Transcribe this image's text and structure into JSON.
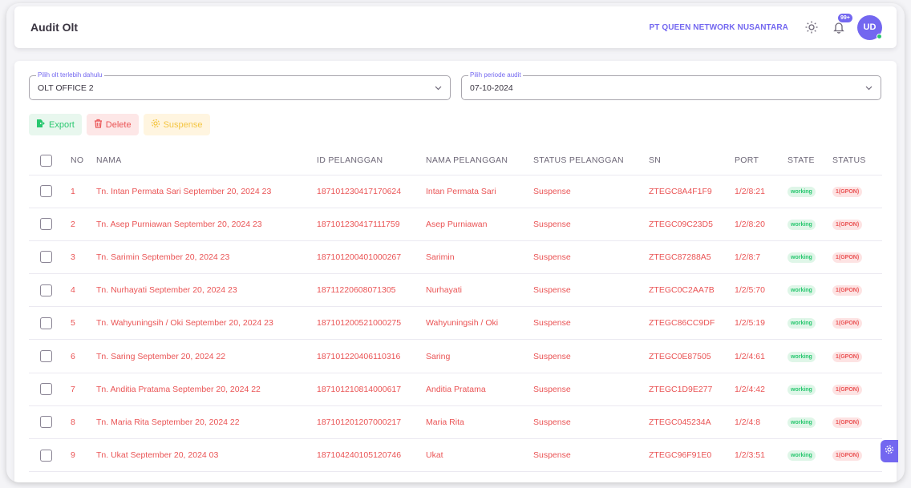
{
  "header": {
    "title": "Audit Olt",
    "company": "PT QUEEN NETWORK NUSANTARA",
    "notif_badge": "99+",
    "avatar_initials": "UD"
  },
  "filters": {
    "olt": {
      "label": "Pilih olt terlebih dahulu",
      "value": "OLT OFFICE 2"
    },
    "period": {
      "label": "Pilih periode audit",
      "value": "07-10-2024"
    }
  },
  "actions": {
    "export": "Export",
    "delete": "Delete",
    "suspense": "Suspense"
  },
  "table": {
    "headers": [
      "NO",
      "NAMA",
      "ID PELANGGAN",
      "NAMA PELANGGAN",
      "STATUS PELANGGAN",
      "SN",
      "PORT",
      "STATE",
      "STATUS"
    ],
    "rows": [
      [
        "1",
        "Tn. Intan Permata Sari September 20, 2024 23",
        "187101230417170624",
        "Intan Permata Sari",
        "Suspense",
        "ZTEGC8A4F1F9",
        "1/2/8:21",
        "working",
        "1(GPON)"
      ],
      [
        "2",
        "Tn. Asep Purniawan September 20, 2024 23",
        "187101230417111759",
        "Asep Purniawan",
        "Suspense",
        "ZTEGC09C23D5",
        "1/2/8:20",
        "working",
        "1(GPON)"
      ],
      [
        "3",
        "Tn. Sarimin September 20, 2024 23",
        "187101200401000267",
        "Sarimin",
        "Suspense",
        "ZTEGC87288A5",
        "1/2/8:7",
        "working",
        "1(GPON)"
      ],
      [
        "4",
        "Tn. Nurhayati September 20, 2024 23",
        "18711220608071305",
        "Nurhayati",
        "Suspense",
        "ZTEGC0C2AA7B",
        "1/2/5:70",
        "working",
        "1(GPON)"
      ],
      [
        "5",
        "Tn. Wahyuningsih / Oki September 20, 2024 23",
        "187101200521000275",
        "Wahyuningsih / Oki",
        "Suspense",
        "ZTEGC86CC9DF",
        "1/2/5:19",
        "working",
        "1(GPON)"
      ],
      [
        "6",
        "Tn. Saring September 20, 2024 22",
        "187101220406110316",
        "Saring",
        "Suspense",
        "ZTEGC0E87505",
        "1/2/4:61",
        "working",
        "1(GPON)"
      ],
      [
        "7",
        "Tn. Anditia Pratama September 20, 2024 22",
        "187101210814000617",
        "Anditia Pratama",
        "Suspense",
        "ZTEGC1D9E277",
        "1/2/4:42",
        "working",
        "1(GPON)"
      ],
      [
        "8",
        "Tn. Maria Rita September 20, 2024 22",
        "187101201207000217",
        "Maria Rita",
        "Suspense",
        "ZTEGC045234A",
        "1/2/4:8",
        "working",
        "1(GPON)"
      ],
      [
        "9",
        "Tn. Ukat September 20, 2024 03",
        "187104240105120746",
        "Ukat",
        "Suspense",
        "ZTEGC96F91E0",
        "1/2/3:51",
        "working",
        "1(GPON)"
      ]
    ]
  },
  "colors": {
    "primary": "#7367f0",
    "danger": "#ea5455",
    "success": "#28c76f",
    "warning": "#f4c542"
  }
}
